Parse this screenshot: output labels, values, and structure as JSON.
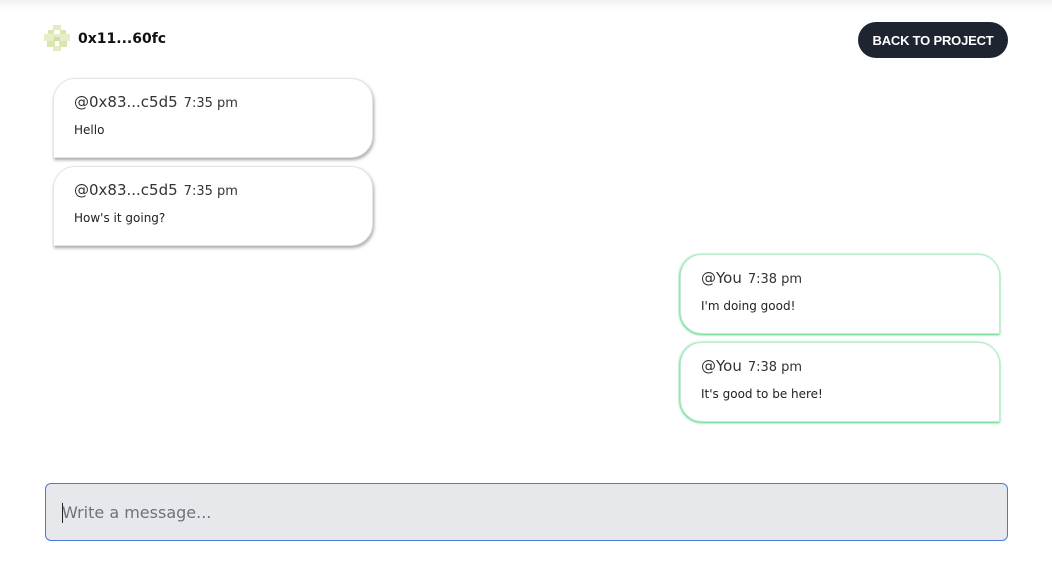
{
  "header": {
    "address": "0x11...60fc",
    "back_label": "BACK TO PROJECT"
  },
  "messages": [
    {
      "handle": "@0x83...c5d5",
      "time": "7:35 pm",
      "text": "Hello",
      "sender": "them"
    },
    {
      "handle": "@0x83...c5d5",
      "time": "7:35 pm",
      "text": "How's it going?",
      "sender": "them"
    },
    {
      "handle": "@You",
      "time": "7:38 pm",
      "text": "I'm doing good!",
      "sender": "you"
    },
    {
      "handle": "@You",
      "time": "7:38 pm",
      "text": "It's good to be here!",
      "sender": "you"
    }
  ],
  "composer": {
    "placeholder": "Write a message...",
    "value": ""
  },
  "colors": {
    "button_bg": "#1e2531",
    "my_bubble_accent": "#22c55e",
    "input_border": "#4a7ad6",
    "input_bg": "#e6e8ec"
  },
  "icons": {
    "avatar": "identicon-avatar-icon"
  }
}
